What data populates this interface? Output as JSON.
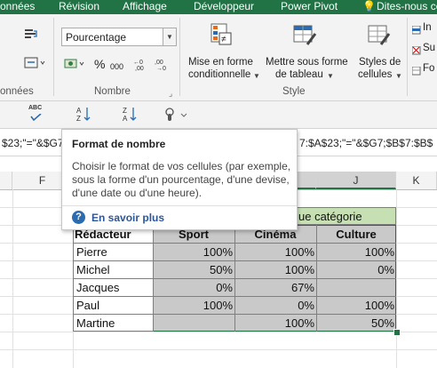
{
  "ribbon_tabs": [
    "onnées",
    "Révision",
    "Affichage",
    "Développeur",
    "Power Pivot",
    "Dites-nous ce"
  ],
  "ribbon": {
    "number_format": {
      "value": "Pourcentage"
    },
    "percent_symbol": "%",
    "thousands_symbol": "000",
    "mise_en_forme_conditionnelle": {
      "line1": "Mise en forme",
      "line2": "conditionnelle"
    },
    "mettre_sous_forme_tableau": {
      "line1": "Mettre sous forme",
      "line2": "de tableau"
    },
    "styles_cellules": {
      "line1": "Styles de",
      "line2": "cellules"
    },
    "groups": {
      "left": "onnées",
      "nombre": "Nombre",
      "style": "Style"
    },
    "side_items": [
      "In",
      "Su",
      "Fo"
    ]
  },
  "qat": {
    "spell_label": "ABC"
  },
  "formula_bar": {
    "left_text": "$23;\"=\"&$G7",
    "right_text": "7:$A$23;\"=\"&$G7;$B$7:$B$"
  },
  "tooltip": {
    "title": "Format de nombre",
    "body": "Choisir le format de vos cellules (par exemple, sous la forme d'un pourcentage, d'une devise, d'une date ou d'une heure).",
    "link": "En savoir plus"
  },
  "grid": {
    "columns": [
      "F",
      "J",
      "K"
    ],
    "banner": "ue catégorie",
    "headers": [
      "Rédacteur",
      "Sport",
      "Cinéma",
      "Culture"
    ],
    "rows": [
      {
        "name": "Pierre",
        "sport": "100%",
        "cinema": "100%",
        "culture": "100%"
      },
      {
        "name": "Michel",
        "sport": "50%",
        "cinema": "100%",
        "culture": "0%"
      },
      {
        "name": "Jacques",
        "sport": "0%",
        "cinema": "67%",
        "culture": ""
      },
      {
        "name": "Paul",
        "sport": "100%",
        "cinema": "0%",
        "culture": "100%"
      },
      {
        "name": "Martine",
        "sport": "",
        "cinema": "100%",
        "culture": "50%"
      }
    ]
  },
  "colors": {
    "accent": "#217346",
    "selection": "#c9c9c9",
    "banner": "#c6e0b4",
    "link": "#2b579a"
  }
}
